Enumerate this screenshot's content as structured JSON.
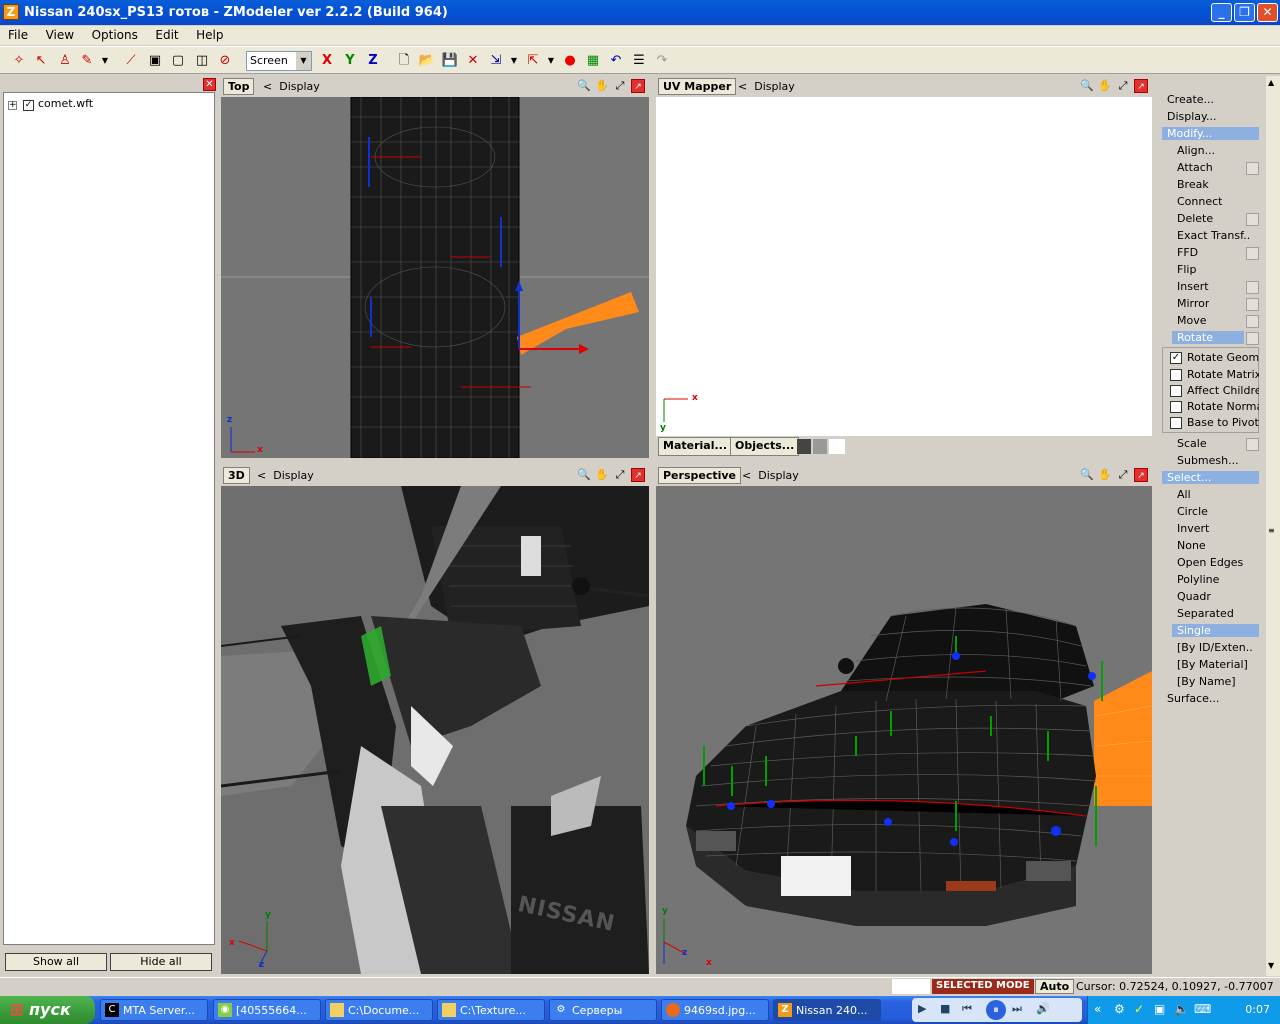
{
  "window": {
    "title": "Nissan 240sx_PS13 готов - ZModeler ver 2.2.2 (Build 964)",
    "app_icon": "Z"
  },
  "menu": [
    "File",
    "View",
    "Options",
    "Edit",
    "Help"
  ],
  "toolbar": {
    "coord_system": "Screen",
    "axis_x": "X",
    "axis_y": "Y",
    "axis_z": "Z"
  },
  "scene_tree": {
    "file": "comet.wft",
    "checked": true,
    "show_all": "Show all",
    "hide_all": "Hide all"
  },
  "viewports": {
    "top": {
      "title": "Top",
      "display": "Display",
      "axes": [
        "z",
        "x"
      ]
    },
    "uv": {
      "title": "UV Mapper",
      "display": "Display",
      "axes": [
        "x",
        "y"
      ],
      "material_btn": "Material...",
      "objects_btn": "Objects..."
    },
    "view3d": {
      "title": "3D",
      "display": "Display",
      "axes": [
        "y",
        "x",
        "z"
      ],
      "watermark": "NISSAN"
    },
    "persp": {
      "title": "Perspective",
      "display": "Display",
      "axes": [
        "y",
        "x",
        "z"
      ]
    }
  },
  "command_panel": {
    "create": "Create...",
    "display": "Display...",
    "modify": "Modify...",
    "modify_items": [
      "Align...",
      "Attach",
      "Break",
      "Connect",
      "Delete",
      "Exact Transf...",
      "FFD",
      "Flip",
      "Insert",
      "Mirror",
      "Move",
      "Rotate"
    ],
    "rotate_options": [
      {
        "label": "Rotate Geome",
        "checked": true
      },
      {
        "label": "Rotate Matrix",
        "checked": false
      },
      {
        "label": "Affect Childrer",
        "checked": false
      },
      {
        "label": "Rotate Norma",
        "checked": false
      },
      {
        "label": "Base to Pivot",
        "checked": false
      }
    ],
    "after_items": [
      "Scale",
      "Submesh..."
    ],
    "select": "Select...",
    "select_items": [
      "All",
      "Circle",
      "Invert",
      "None",
      "Open Edges",
      "Polyline",
      "Quadr",
      "Separated",
      "Single",
      "[By ID/Exten...",
      "[By Material]",
      "[By Name]"
    ],
    "surface": "Surface..."
  },
  "status": {
    "mode": "SELECTED MODE",
    "auto": "Auto",
    "cursor": "Cursor: 0.72524, 0.10927, -0.77007"
  },
  "taskbar": {
    "start": "пуск",
    "tasks": [
      {
        "label": "MTA Server...",
        "icon": "cmd-icon"
      },
      {
        "label": "[40555664...",
        "icon": "chat-icon"
      },
      {
        "label": "C:\\Docume...",
        "icon": "folder-icon"
      },
      {
        "label": "C:\\Texture...",
        "icon": "folder-icon"
      },
      {
        "label": "Серверы",
        "icon": "steam-icon"
      },
      {
        "label": "9469sd.jpg...",
        "icon": "firefox-icon"
      },
      {
        "label": "Nissan 240...",
        "icon": "zmodeler-icon"
      }
    ],
    "clock": "0:07"
  },
  "colors": {
    "title_blue": "#0454d6",
    "selection_orange": "#ff8a1a",
    "highlight": "#a8c4e8",
    "selected_mode": "#9a2a1a"
  }
}
